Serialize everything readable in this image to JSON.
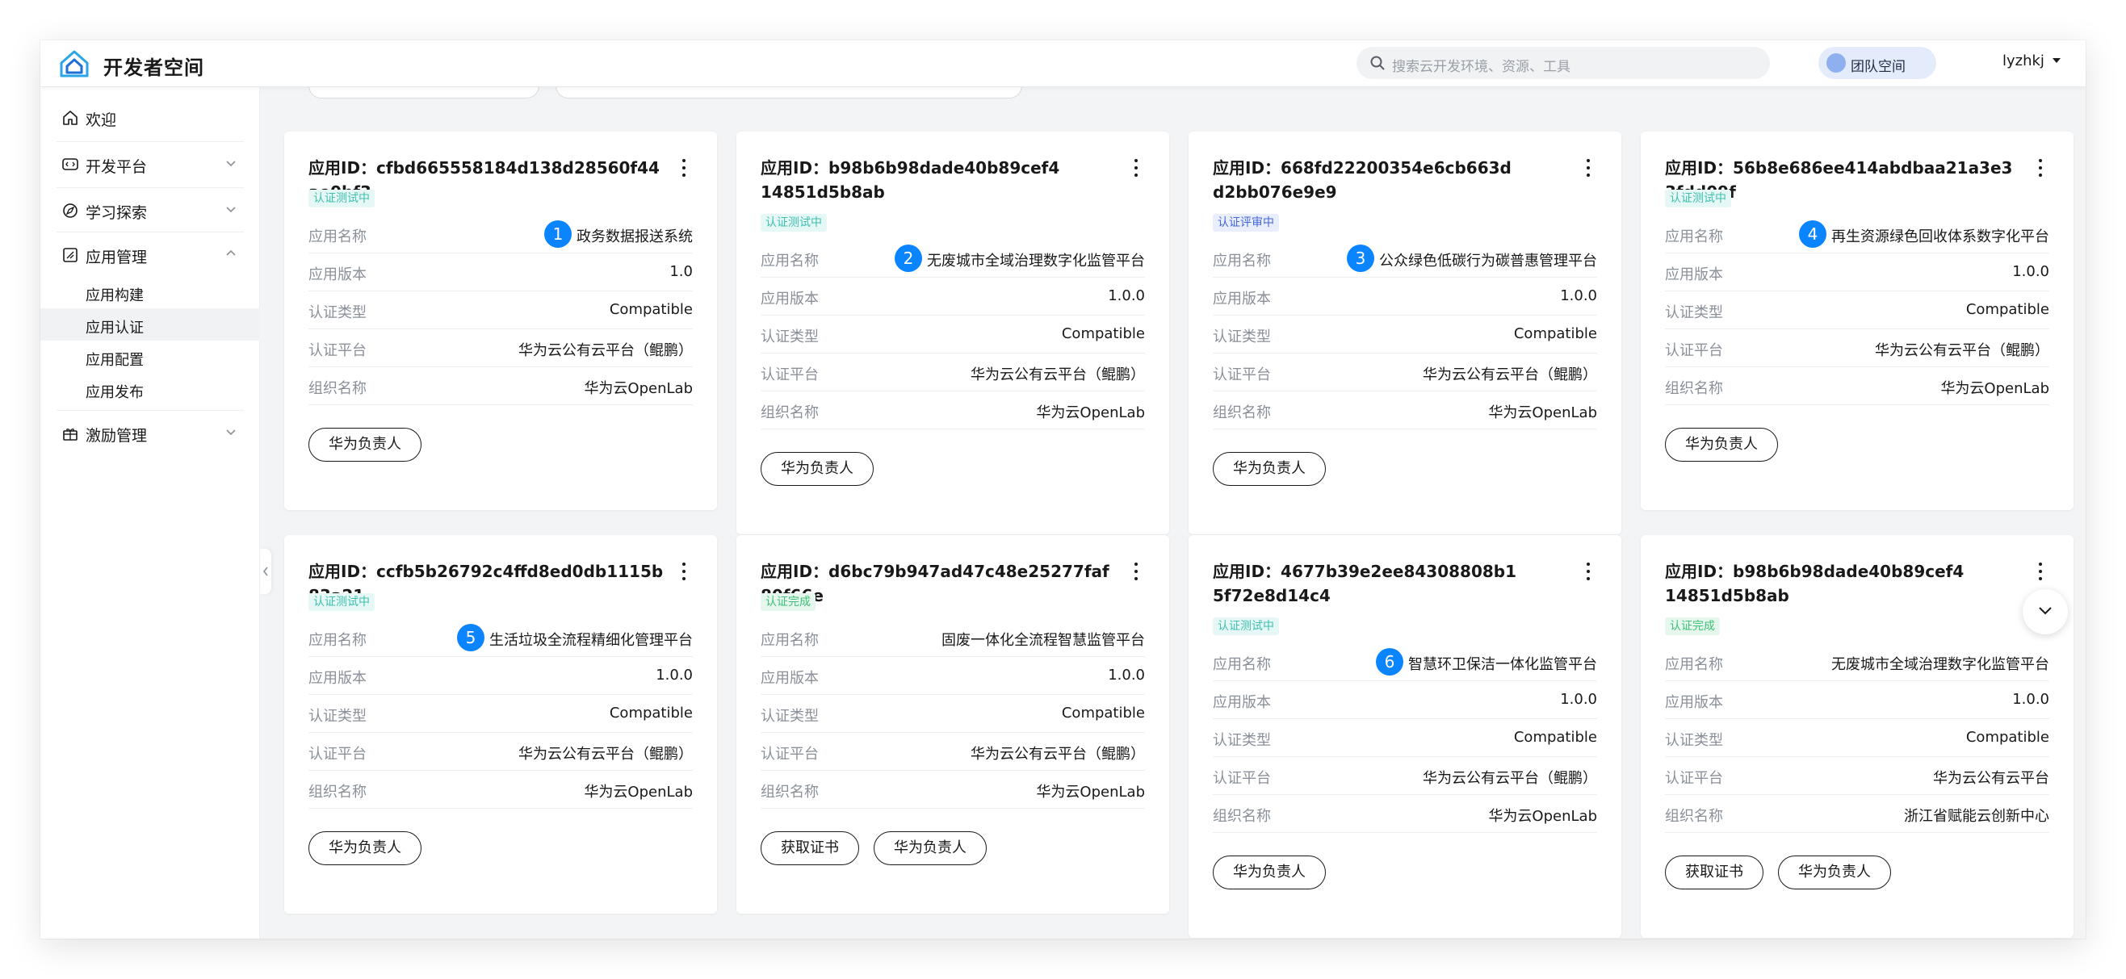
{
  "brand": "开发者空间",
  "search": {
    "placeholder": "搜索云开发环境、资源、工具"
  },
  "team": {
    "label": "团队空间"
  },
  "user": {
    "name": "lyzhkj"
  },
  "sidebar": {
    "welcome": "欢迎",
    "dev_platform": "开发平台",
    "learn": "学习探索",
    "app_mgmt": "应用管理",
    "sub": [
      "应用构建",
      "应用认证",
      "应用配置",
      "应用发布"
    ],
    "incentive": "激励管理"
  },
  "labels": {
    "name": "应用名称",
    "version": "应用版本",
    "type": "认证类型",
    "platform": "认证平台",
    "org": "组织名称",
    "owner_btn": "华为负责人",
    "cert_btn": "获取证书"
  },
  "cards": [
    {
      "title": "应用ID：cfbd665558184d138d28560f44ae0bf3",
      "status": "认证测试中",
      "badge": "1",
      "name": "政务数据报送系统",
      "version": "1.0",
      "type": "Compatible",
      "platform": "华为云公有云平台（鲲鹏）",
      "org": "华为云OpenLab"
    },
    {
      "title": "应用ID：b98b6b98dade40b89cef414851d5b8ab",
      "status": "认证测试中",
      "badge": "2",
      "name": "无废城市全域治理数字化监管平台",
      "version": "1.0.0",
      "type": "Compatible",
      "platform": "华为云公有云平台（鲲鹏）",
      "org": "华为云OpenLab"
    },
    {
      "title": "应用ID：668fd22200354e6cb663dd2bb076e9e9",
      "status": "认证评审中",
      "badge": "3",
      "name": "公众绿色低碳行为碳普惠管理平台",
      "version": "1.0.0",
      "type": "Compatible",
      "platform": "华为云公有云平台（鲲鹏）",
      "org": "华为云OpenLab"
    },
    {
      "title": "应用ID：56b8e686ee414abdbaa21a3e33fdd09f",
      "status": "认证测试中",
      "badge": "4",
      "name": "再生资源绿色回收体系数字化平台",
      "version": "1.0.0",
      "type": "Compatible",
      "platform": "华为云公有云平台（鲲鹏）",
      "org": "华为云OpenLab"
    },
    {
      "title": "应用ID：ccfb5b26792c4ffd8ed0db1115b83a21",
      "status": "认证测试中",
      "badge": "5",
      "name": "生活垃圾全流程精细化管理平台",
      "version": "1.0.0",
      "type": "Compatible",
      "platform": "华为云公有云平台（鲲鹏）",
      "org": "华为云OpenLab"
    },
    {
      "title": "应用ID：d6bc79b947ad47c48e25277faf80f66e",
      "status": "认证完成",
      "badge": "",
      "name": "固废一体化全流程智慧监管平台",
      "version": "1.0.0",
      "type": "Compatible",
      "platform": "华为云公有云平台（鲲鹏）",
      "org": "华为云OpenLab"
    },
    {
      "title": "应用ID：4677b39e2ee84308808b15f72e8d14c4",
      "status": "认证测试中",
      "badge": "6",
      "name": "智慧环卫保洁一体化监管平台",
      "version": "1.0.0",
      "type": "Compatible",
      "platform": "华为云公有云平台（鲲鹏）",
      "org": "华为云OpenLab"
    },
    {
      "title": "应用ID：b98b6b98dade40b89cef414851d5b8ab",
      "status": "认证完成",
      "badge": "",
      "name": "无废城市全域治理数字化监管平台",
      "version": "1.0.0",
      "type": "Compatible",
      "platform": "华为云公有云平台",
      "org": "浙江省赋能云创新中心"
    }
  ]
}
